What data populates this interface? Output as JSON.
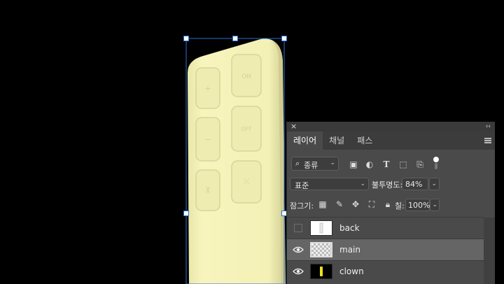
{
  "colors": {
    "canvas_bg": "#000000",
    "object": "#f5f2b8",
    "selection": "#2a6fd6",
    "panel_bg": "#4a4a4a",
    "selected_row": "#656565"
  },
  "canvas": {
    "remote_buttons": [
      {
        "glyph": "+"
      },
      {
        "glyph": "ON"
      },
      {
        "glyph": "−"
      },
      {
        "glyph": "OFF"
      },
      {
        "glyph": "⊻"
      },
      {
        "glyph": "⤫"
      }
    ]
  },
  "panel": {
    "close_icon": "×",
    "collapse_icon": "‹‹",
    "tabs": [
      {
        "label": "레이어",
        "active": true
      },
      {
        "label": "채널",
        "active": false
      },
      {
        "label": "패스",
        "active": false
      }
    ],
    "filter": {
      "kind_label": "종류",
      "icons": [
        "image-filter-icon",
        "adjustment-filter-icon",
        "type-filter-icon",
        "shape-filter-icon",
        "smart-object-filter-icon",
        "filter-toggle-icon"
      ]
    },
    "blend_mode": "표준",
    "opacity_label": "불투명도:",
    "opacity_value": "84%",
    "lock_label": "잠그기:",
    "lock_icons": [
      "lock-transparent-icon",
      "lock-image-icon",
      "lock-position-icon",
      "lock-artboard-icon",
      "lock-all-icon"
    ],
    "fill_label": "칠:",
    "fill_value": "100%",
    "layers": [
      {
        "name": "back",
        "visible": false,
        "selected": false,
        "thumb": "white"
      },
      {
        "name": "main",
        "visible": true,
        "selected": true,
        "thumb": "checker"
      },
      {
        "name": "clown",
        "visible": true,
        "selected": false,
        "thumb": "black-yellow"
      }
    ]
  }
}
